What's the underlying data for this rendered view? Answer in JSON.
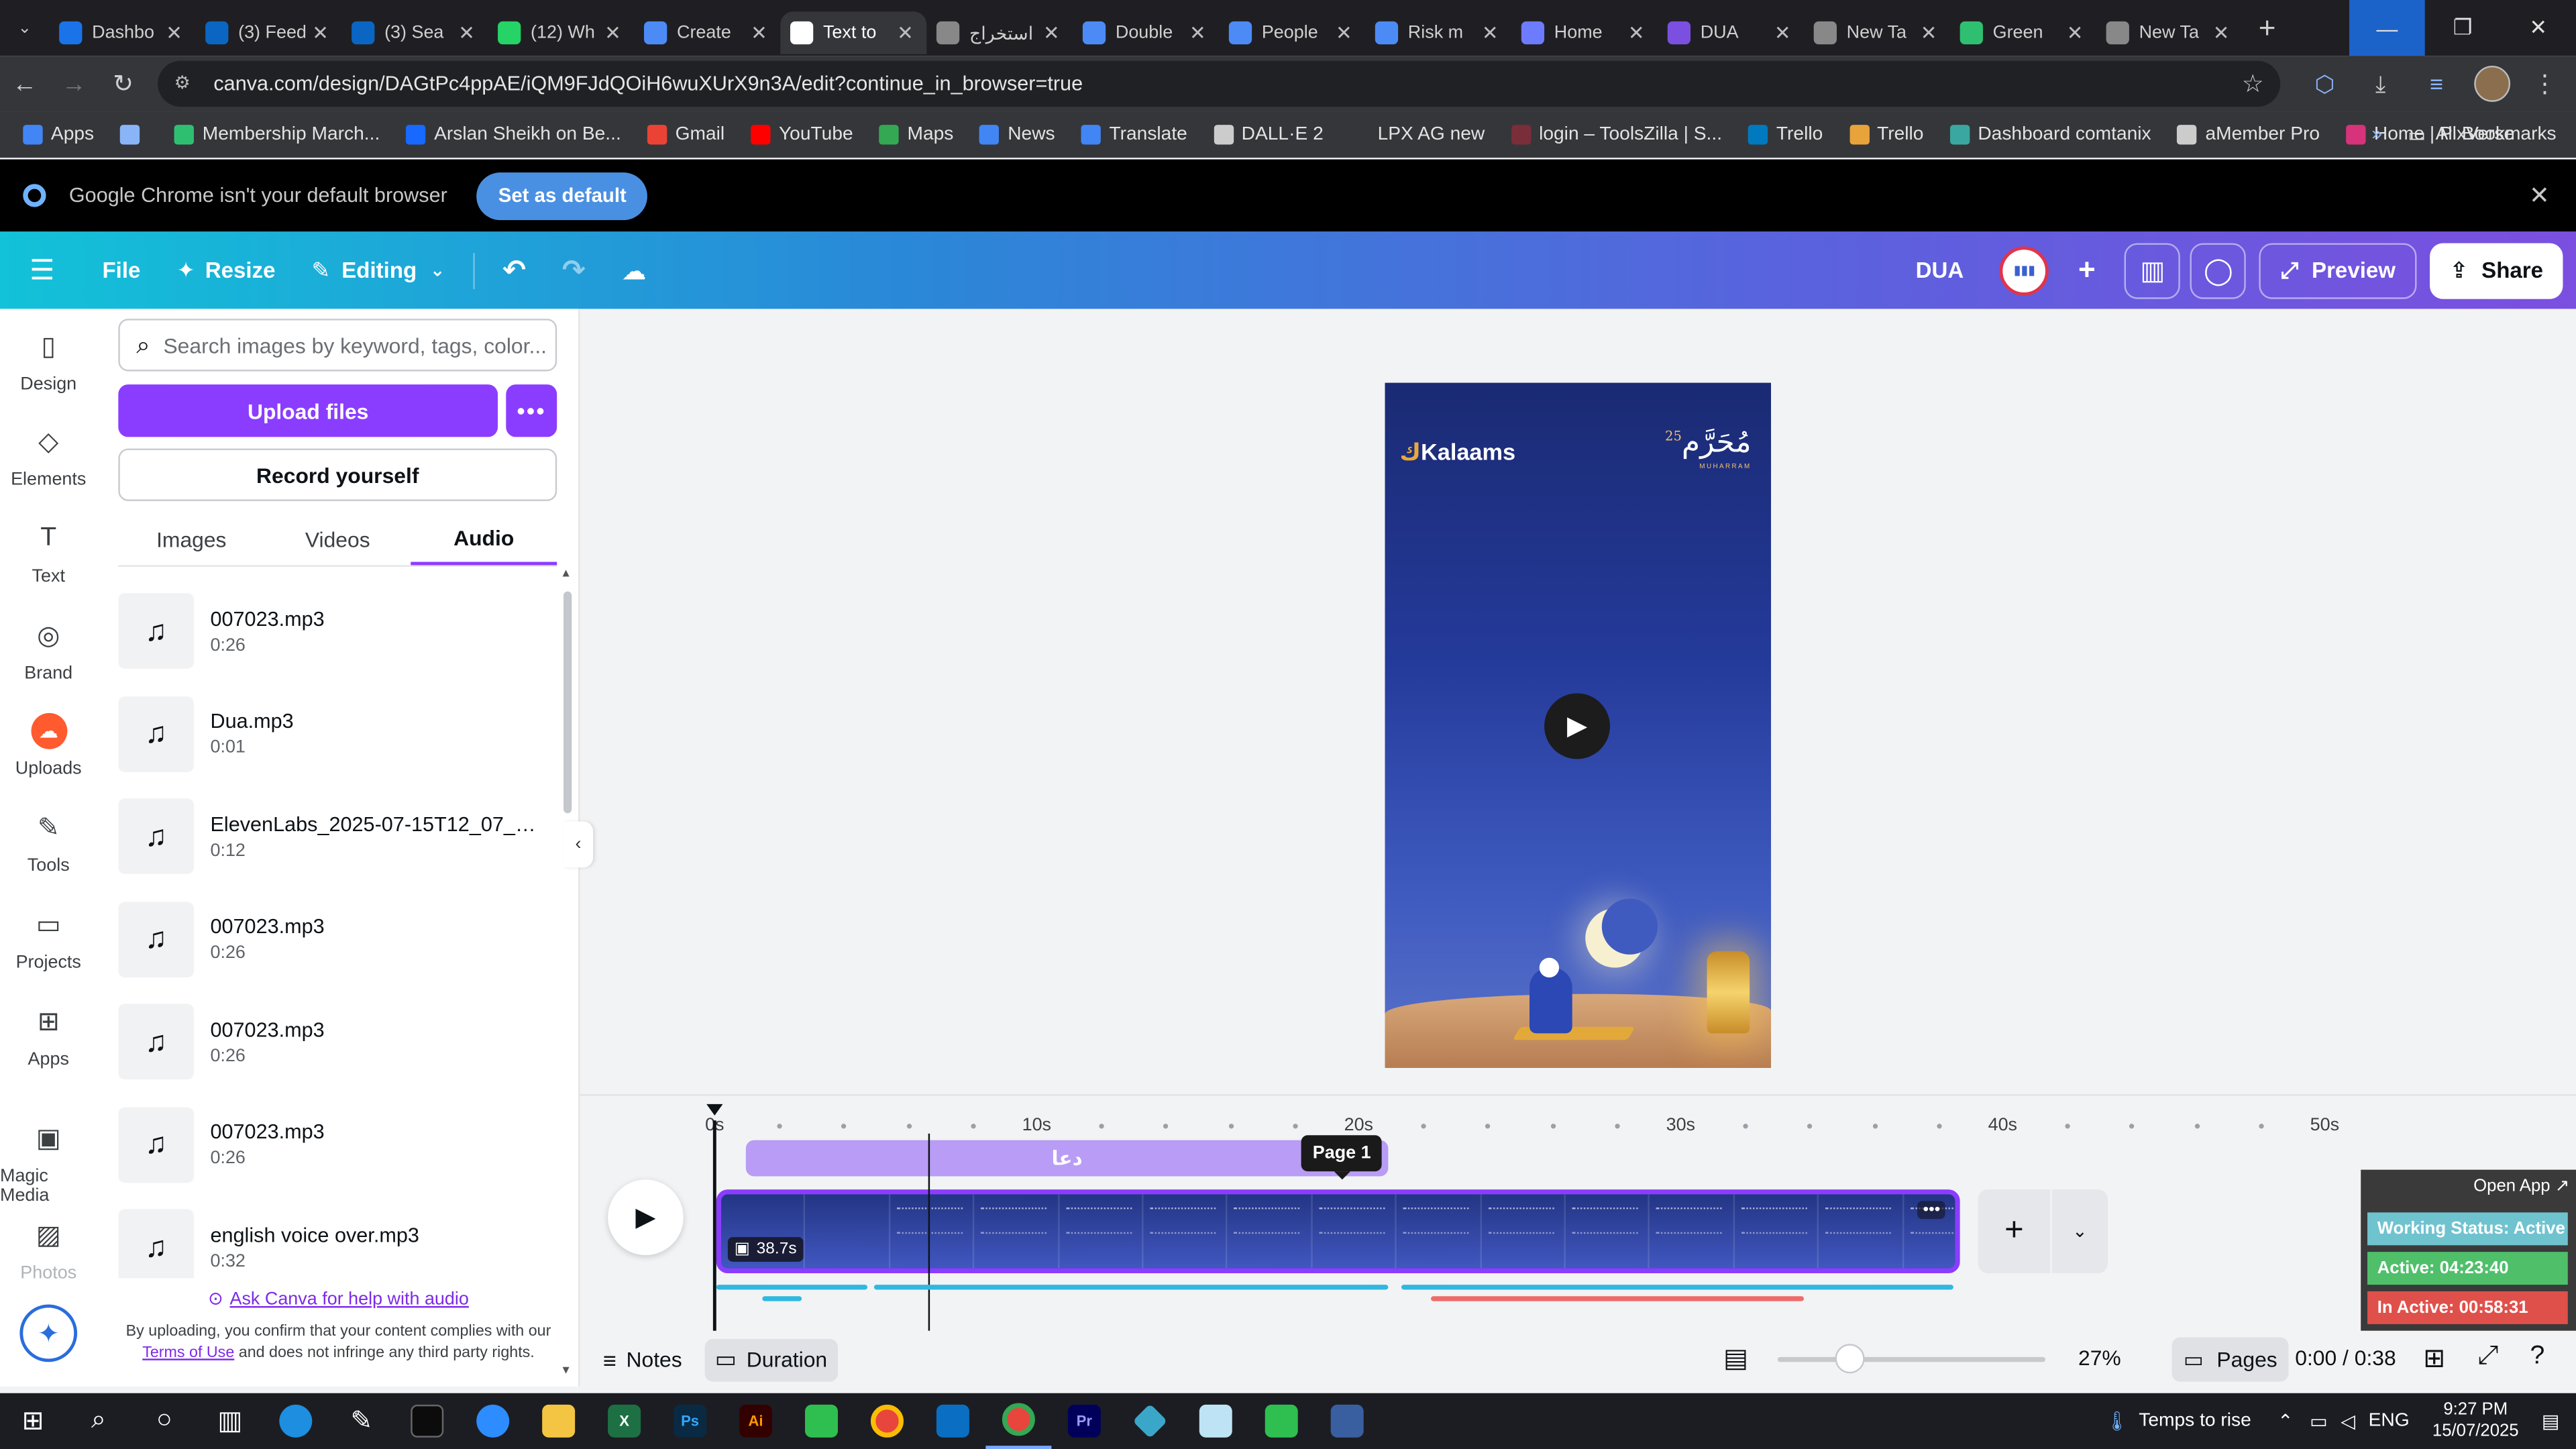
{
  "browser": {
    "tabs": [
      {
        "title": "Dashbo",
        "favicon_color": "#1a73e8",
        "active": false
      },
      {
        "title": "(3) Feed",
        "favicon_color": "#0a66c2",
        "active": false
      },
      {
        "title": "(3) Sea",
        "favicon_color": "#0a66c2",
        "active": false
      },
      {
        "title": "(12) Wh",
        "favicon_color": "#25d366",
        "active": false
      },
      {
        "title": "Create",
        "favicon_color": "#4c8bf5",
        "active": false
      },
      {
        "title": "Text to",
        "favicon_color": "#ffffff",
        "active": true
      },
      {
        "title": "استخراج",
        "favicon_color": "#888888",
        "active": false
      },
      {
        "title": "Double",
        "favicon_color": "#4c8bf5",
        "active": false
      },
      {
        "title": "People",
        "favicon_color": "#4c8bf5",
        "active": false
      },
      {
        "title": "Risk m",
        "favicon_color": "#4c8bf5",
        "active": false
      },
      {
        "title": "Home",
        "favicon_color": "#6d7bff",
        "active": false
      },
      {
        "title": "DUA",
        "favicon_color": "#7b4fe0",
        "active": false
      },
      {
        "title": "New Ta",
        "favicon_color": "#888888",
        "active": false
      },
      {
        "title": "Green",
        "favicon_color": "#2fbf71",
        "active": false
      },
      {
        "title": "New Ta",
        "favicon_color": "#888888",
        "active": false
      }
    ],
    "url": "canva.com/design/DAGtPc4ppAE/iQM9FJdQOiH6wuXUrX9n3A/edit?continue_in_browser=true",
    "bookmarks": [
      {
        "label": "Apps",
        "color": "#4285f4"
      },
      {
        "label": "",
        "color": "#8ab4f8"
      },
      {
        "label": "Membership March...",
        "color": "#2fbf71"
      },
      {
        "label": "Arslan Sheikh on Be...",
        "color": "#1769ff"
      },
      {
        "label": "Gmail",
        "color": "#ea4335"
      },
      {
        "label": "YouTube",
        "color": "#ff0000"
      },
      {
        "label": "Maps",
        "color": "#34a853"
      },
      {
        "label": "News",
        "color": "#4285f4"
      },
      {
        "label": "Translate",
        "color": "#4285f4"
      },
      {
        "label": "DALL·E 2",
        "color": "#cccccc"
      },
      {
        "label": "LPX AG new",
        "color": "#35363a"
      },
      {
        "label": "login – ToolsZilla | S...",
        "color": "#7a2e3a"
      },
      {
        "label": "Trello",
        "color": "#0079bf"
      },
      {
        "label": "Trello",
        "color": "#e8a33a"
      },
      {
        "label": "Dashboard comtanix",
        "color": "#3aa7a0"
      },
      {
        "label": "aMember Pro",
        "color": "#cccccc"
      },
      {
        "label": "Home | PixVerse",
        "color": "#d6337a"
      }
    ],
    "all_bookmarks": "All Bookmarks",
    "infobar": {
      "message": "Google Chrome isn't your default browser",
      "button": "Set as default"
    }
  },
  "canva_header": {
    "file": "File",
    "resize": "Resize",
    "editing": "Editing",
    "design_title": "DUA",
    "preview": "Preview",
    "share": "Share"
  },
  "rail": [
    {
      "label": "Design",
      "icon": "▯"
    },
    {
      "label": "Elements",
      "icon": "◇"
    },
    {
      "label": "Text",
      "icon": "T"
    },
    {
      "label": "Brand",
      "icon": "◎"
    },
    {
      "label": "Uploads",
      "icon": "☁"
    },
    {
      "label": "Tools",
      "icon": "✎"
    },
    {
      "label": "Projects",
      "icon": "▭"
    },
    {
      "label": "Apps",
      "icon": "⊞"
    },
    {
      "label": "Magic Media",
      "icon": "▣"
    },
    {
      "label": "Photos",
      "icon": "▨"
    }
  ],
  "panel": {
    "search_placeholder": "Search images by keyword, tags, color...",
    "upload": "Upload files",
    "record": "Record yourself",
    "tabs": [
      "Images",
      "Videos",
      "Audio"
    ],
    "active_tab": "Audio",
    "audio": [
      {
        "name": "007023.mp3",
        "duration": "0:26"
      },
      {
        "name": "Dua.mp3",
        "duration": "0:01"
      },
      {
        "name": "ElevenLabs_2025-07-15T12_07_02_...",
        "duration": "0:12"
      },
      {
        "name": "007023.mp3",
        "duration": "0:26"
      },
      {
        "name": "007023.mp3",
        "duration": "0:26"
      },
      {
        "name": "007023.mp3",
        "duration": "0:26"
      },
      {
        "name": "english voice over.mp3",
        "duration": "0:32"
      }
    ],
    "ask": "Ask Canva for help with audio",
    "disclaimer_pre": "By uploading, you confirm that your content complies with our ",
    "terms": "Terms of Use",
    "disclaimer_post": " and does not infringe any third party rights."
  },
  "design": {
    "brand": "Kalaams",
    "arabic_title": "مُحَرَّم",
    "date_num": "25",
    "muharram": "MUHARRAM"
  },
  "timeline": {
    "ruler": [
      "0s",
      "10s",
      "20s",
      "30s",
      "40s",
      "50s"
    ],
    "audio_track_label": "دعا",
    "page_tooltip": "Page 1",
    "clip_duration": "38.7s",
    "clip_more": "•••"
  },
  "status_widget": {
    "open_app": "Open App ↗",
    "working_status": "Working Status: Active",
    "active": "Active: 04:23:40",
    "inactive": "In Active: 00:58:31",
    "colors": {
      "working": "#6fc3cf",
      "active": "#4fbf6a",
      "inactive": "#e0504a"
    }
  },
  "bottombar": {
    "notes": "Notes",
    "duration": "Duration",
    "zoom": "27%",
    "pages": "Pages",
    "time": "0:00 / 0:38"
  },
  "taskbar": {
    "weather": "Temps to rise",
    "lang": "ENG",
    "time": "9:27 PM",
    "date": "15/07/2025"
  }
}
